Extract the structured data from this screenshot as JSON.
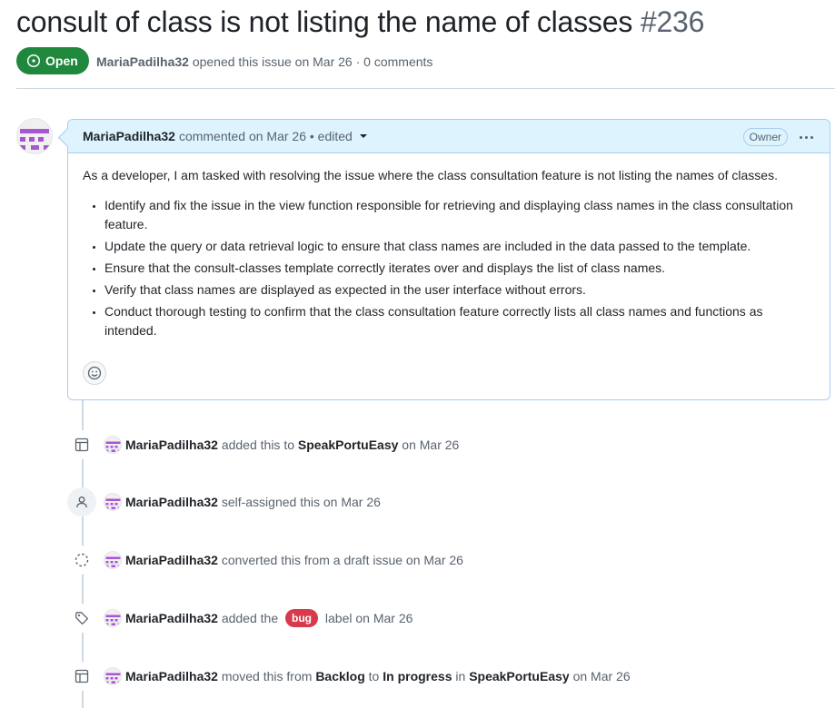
{
  "issue": {
    "title": "consult of class is not listing the name of classes",
    "number": "#236",
    "state": "Open",
    "author": "MariaPadilha32",
    "meta_suffix": " opened this issue on Mar 26 · 0 comments"
  },
  "comment": {
    "author": "MariaPadilha32",
    "header_text": "commented on Mar 26 • edited",
    "owner_badge": "Owner",
    "intro": "As a developer, I am tasked with resolving the issue where the class consultation feature is not listing the names of classes.",
    "bullets": [
      "Identify and fix the issue in the view function responsible for retrieving and displaying class names in the class consultation feature.",
      "Update the query or data retrieval logic to ensure that class names are included in the data passed to the template.",
      "Ensure that the consult-classes template correctly iterates over and displays the list of class names.",
      "Verify that class names are displayed as expected in the user interface without errors.",
      "Conduct thorough testing to confirm that the class consultation feature correctly lists all class names and functions as intended."
    ]
  },
  "timeline": {
    "e1": {
      "icon": "project-table-icon",
      "actor": "MariaPadilha32",
      "text1": " added this to ",
      "project": "SpeakPortuEasy",
      "text2": " on Mar 26"
    },
    "e2": {
      "icon": "person-icon",
      "actor": "MariaPadilha32",
      "text1": " self-assigned this on Mar 26"
    },
    "e3": {
      "icon": "dashed-circle-icon",
      "actor": "MariaPadilha32",
      "text1": " converted this from a draft issue on Mar 26"
    },
    "e4": {
      "icon": "tag-icon",
      "actor": "MariaPadilha32",
      "text1": " added the ",
      "label": "bug",
      "text2": " label on Mar 26",
      "label_color": "#d73a4a"
    },
    "e5": {
      "icon": "project-table-icon",
      "actor": "MariaPadilha32",
      "text1": " moved this from ",
      "from": "Backlog",
      "text2": " to ",
      "to": "In progress",
      "text3": " in ",
      "project": "SpeakPortuEasy",
      "text4": " on Mar 26"
    }
  },
  "colors": {
    "open_green": "#1f883d",
    "comment_header_bg": "#ddf4ff",
    "comment_border": "#a9cdf0",
    "avatar_purple": "#a855d4"
  }
}
